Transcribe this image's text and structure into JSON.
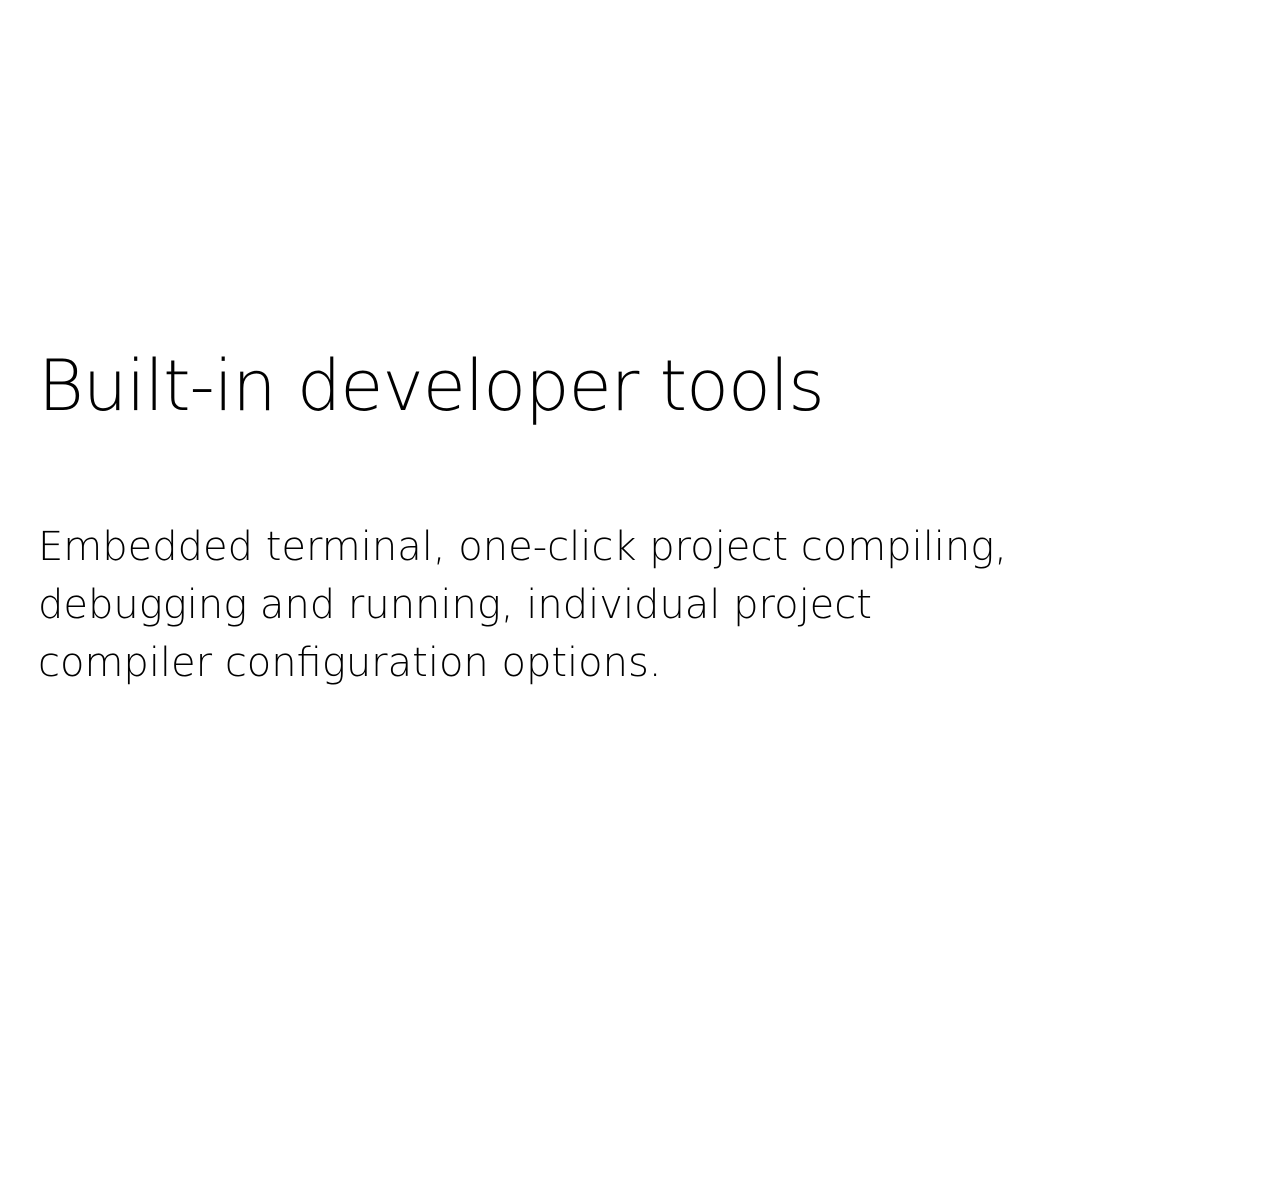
{
  "feature": {
    "title": "Built-in developer tools",
    "description_lines": [
      "Embedded terminal, one-click project compiling,",
      "debugging and running, individual project",
      "compiler configuration options."
    ]
  },
  "colors": {
    "background": "#ffffff",
    "text": "#000000"
  }
}
